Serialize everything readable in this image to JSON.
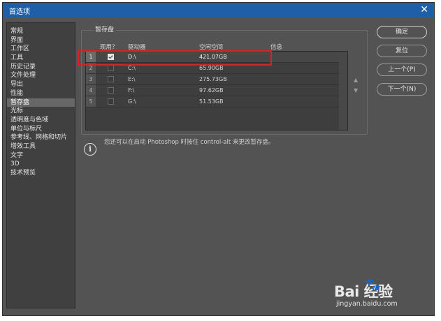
{
  "window": {
    "title": "首选项",
    "close_glyph": "✕"
  },
  "sidebar": {
    "items": [
      {
        "label": "常规"
      },
      {
        "label": "界面"
      },
      {
        "label": "工作区"
      },
      {
        "label": "工具"
      },
      {
        "label": "历史记录"
      },
      {
        "label": "文件处理"
      },
      {
        "label": "导出"
      },
      {
        "label": "性能"
      },
      {
        "label": "暂存盘",
        "active": true
      },
      {
        "label": "光标"
      },
      {
        "label": "透明度与色域"
      },
      {
        "label": "单位与标尺"
      },
      {
        "label": "参考线、网格和切片"
      },
      {
        "label": "增效工具"
      },
      {
        "label": "文字"
      },
      {
        "label": "3D"
      },
      {
        "label": "技术预览"
      }
    ]
  },
  "scratch": {
    "group_label": "暂存盘",
    "columns": {
      "active": "现用？",
      "drive": "驱动器",
      "free": "空闲空间",
      "info": "信息"
    },
    "rows": [
      {
        "num": "1",
        "checked": true,
        "drive": "D:\\",
        "free": "421.07GB"
      },
      {
        "num": "2",
        "checked": false,
        "drive": "C:\\",
        "free": "65.90GB"
      },
      {
        "num": "3",
        "checked": false,
        "drive": "E:\\",
        "free": "275.73GB"
      },
      {
        "num": "4",
        "checked": false,
        "drive": "F:\\",
        "free": "97.62GB"
      },
      {
        "num": "5",
        "checked": false,
        "drive": "G:\\",
        "free": "51.53GB"
      }
    ],
    "up_arrow": "▲",
    "down_arrow": "▼"
  },
  "info": {
    "icon_glyph": "i",
    "text": "您还可以在启动 Photoshop 时按住 control-alt 来更改暂存盘。"
  },
  "buttons": {
    "ok": "确定",
    "reset": "复位",
    "prev": "上一个(P)",
    "next": "下一个(N)"
  },
  "watermark": {
    "logo_text": "Bai  经验",
    "paw": "🐾",
    "url": "jingyan.baidu.com"
  },
  "colors": {
    "titlebar": "#1f5fa8",
    "dialog_bg": "#535353",
    "highlight_box": "#d32424"
  }
}
